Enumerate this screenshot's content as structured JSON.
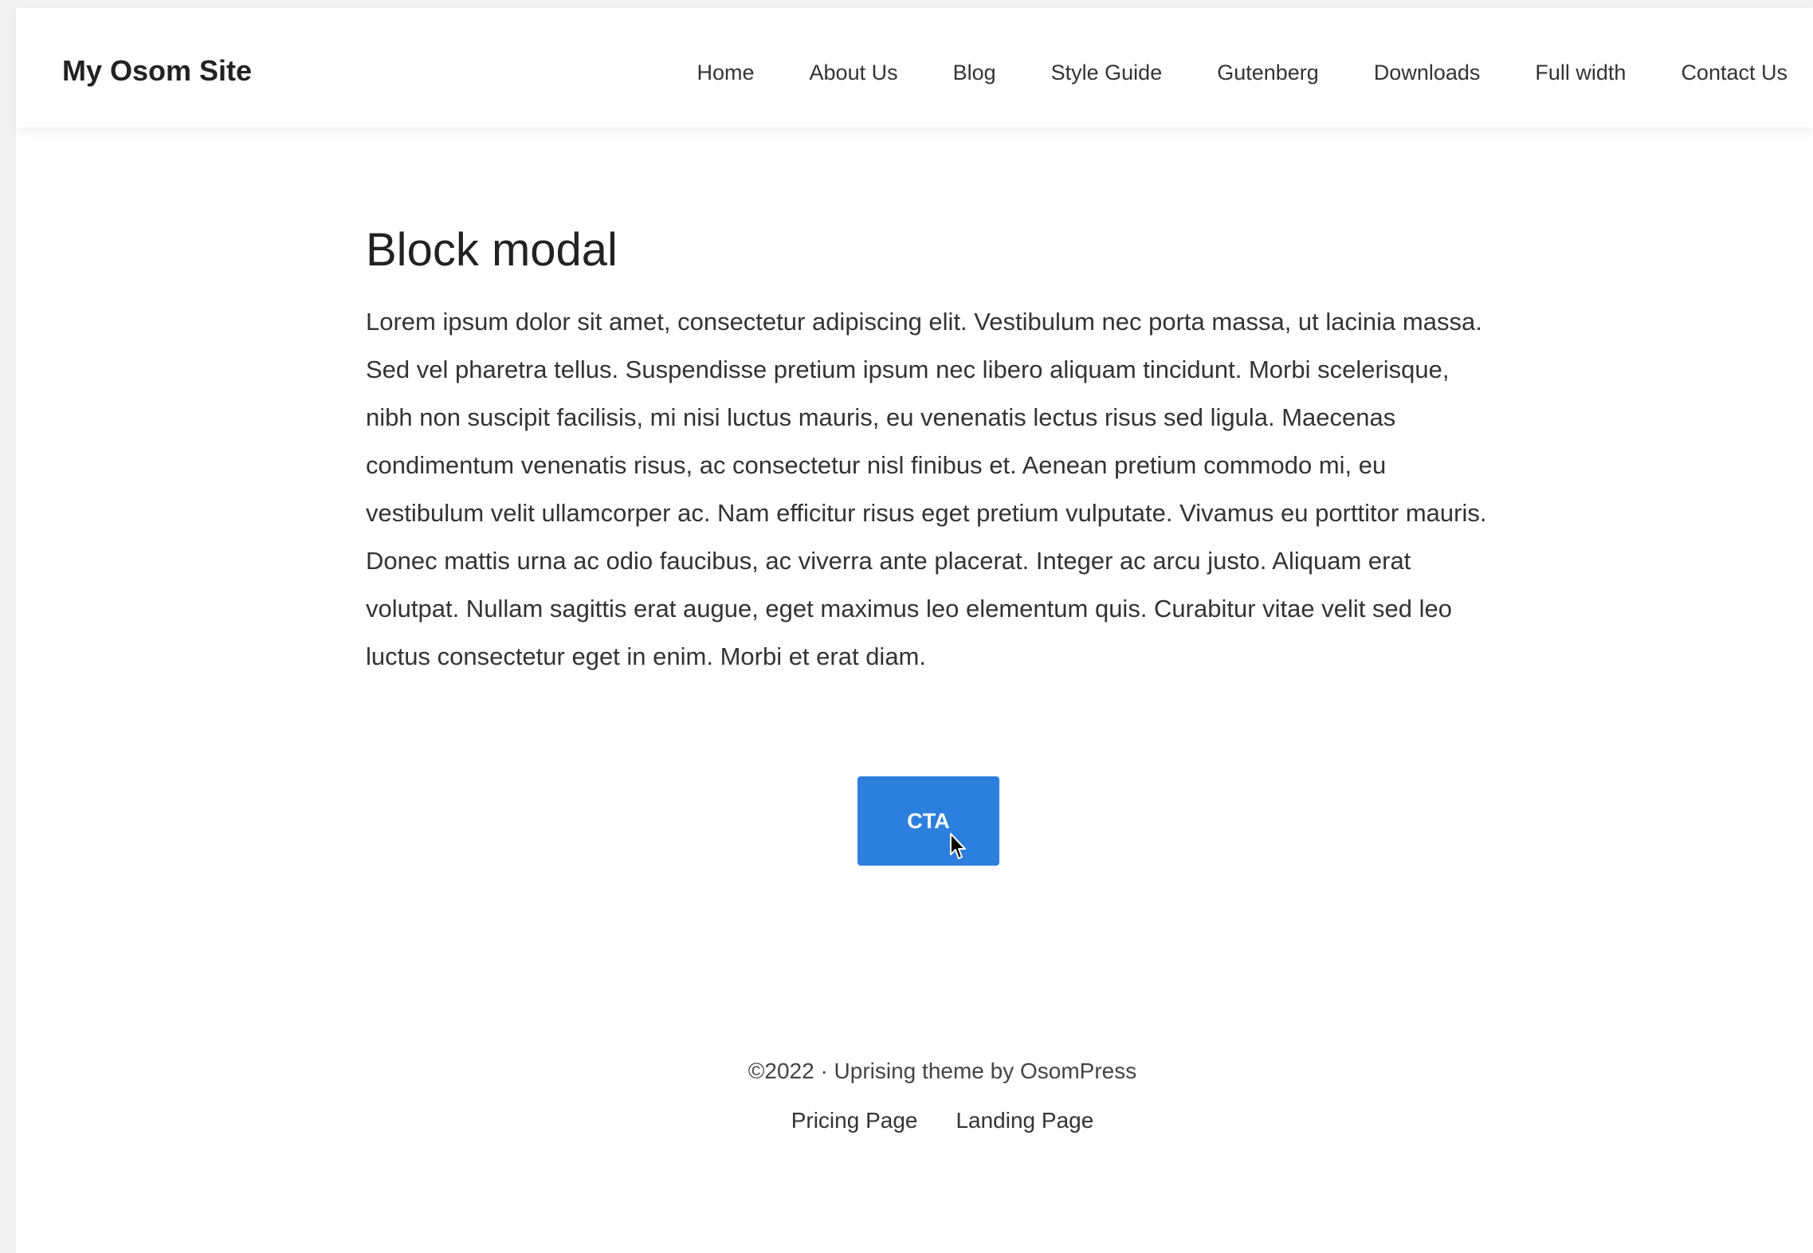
{
  "site": {
    "title": "My Osom Site"
  },
  "nav": {
    "items": [
      {
        "label": "Home"
      },
      {
        "label": "About Us"
      },
      {
        "label": "Blog"
      },
      {
        "label": "Style Guide"
      },
      {
        "label": "Gutenberg"
      },
      {
        "label": "Downloads"
      },
      {
        "label": "Full width"
      },
      {
        "label": "Contact Us"
      }
    ]
  },
  "main": {
    "title": "Block modal",
    "body": "Lorem ipsum dolor sit amet, consectetur adipiscing elit. Vestibulum nec porta massa, ut lacinia massa. Sed vel pharetra tellus. Suspendisse pretium ipsum nec libero aliquam tincidunt. Morbi scelerisque, nibh non suscipit facilisis, mi nisi luctus mauris, eu venenatis lectus risus sed ligula. Maecenas condimentum venenatis risus, ac consectetur nisl finibus et. Aenean pretium commodo mi, eu vestibulum velit ullamcorper ac. Nam efficitur risus eget pretium vulputate. Vivamus eu porttitor mauris. Donec mattis urna ac odio faucibus, ac viverra ante placerat. Integer ac arcu justo. Aliquam erat volutpat. Nullam sagittis erat augue, eget maximus leo elementum quis. Curabitur vitae velit sed leo luctus consectetur eget in enim. Morbi et erat diam.",
    "cta_label": "CTA"
  },
  "footer": {
    "copyright": "©2022 · Uprising theme by OsomPress",
    "links": [
      {
        "label": "Pricing Page"
      },
      {
        "label": "Landing Page"
      }
    ]
  },
  "colors": {
    "accent": "#2d7fdd",
    "background": "#ffffff",
    "text": "#333333"
  },
  "icons": {
    "cursor": "mouse-pointer-icon"
  }
}
